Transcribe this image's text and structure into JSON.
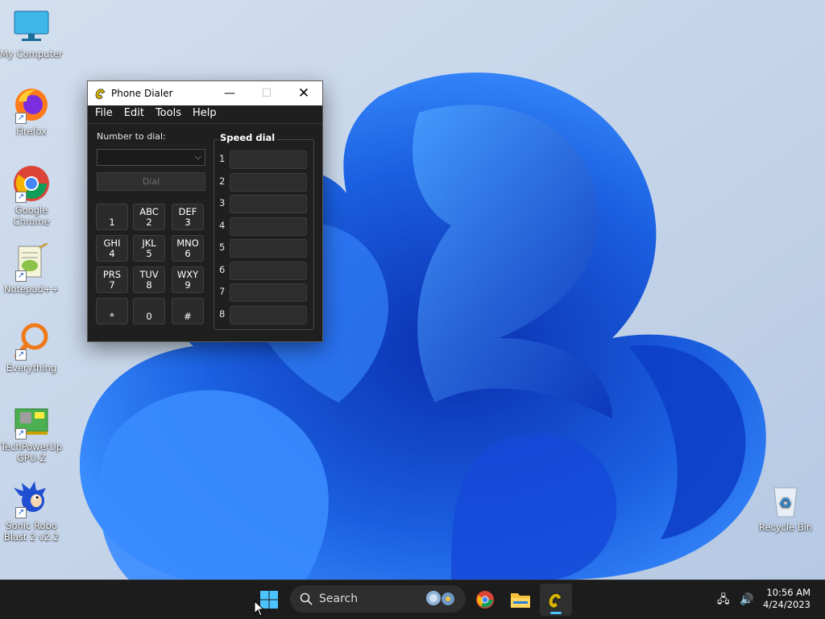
{
  "desktop": {
    "icons": [
      {
        "name": "my-computer",
        "label": "My Computer"
      },
      {
        "name": "firefox",
        "label": "Firefox"
      },
      {
        "name": "google-chrome",
        "label": "Google Chrome"
      },
      {
        "name": "notepad-plus-plus",
        "label": "Notepad++"
      },
      {
        "name": "everything",
        "label": "Everything"
      },
      {
        "name": "gpu-z",
        "label": "TechPowerUp GPU-Z"
      },
      {
        "name": "sonic-robo-blast",
        "label": "Sonic Robo Blast 2 v2.2"
      },
      {
        "name": "recycle-bin",
        "label": "Recycle Bin"
      }
    ]
  },
  "window": {
    "title": "Phone Dialer",
    "menu": [
      "File",
      "Edit",
      "Tools",
      "Help"
    ],
    "number_label": "Number to dial:",
    "dial_button": "Dial",
    "keypad": [
      {
        "letters": "",
        "digit": "1"
      },
      {
        "letters": "ABC",
        "digit": "2"
      },
      {
        "letters": "DEF",
        "digit": "3"
      },
      {
        "letters": "GHI",
        "digit": "4"
      },
      {
        "letters": "JKL",
        "digit": "5"
      },
      {
        "letters": "MNO",
        "digit": "6"
      },
      {
        "letters": "PRS",
        "digit": "7"
      },
      {
        "letters": "TUV",
        "digit": "8"
      },
      {
        "letters": "WXY",
        "digit": "9"
      },
      {
        "letters": "",
        "digit": "*"
      },
      {
        "letters": "",
        "digit": "0"
      },
      {
        "letters": "",
        "digit": "#"
      }
    ],
    "speed_dial_title": "Speed dial",
    "speed_dial_numbers": [
      "1",
      "2",
      "3",
      "4",
      "5",
      "6",
      "7",
      "8"
    ]
  },
  "taskbar": {
    "search_label": "Search",
    "time": "10:56 AM",
    "date": "4/24/2023",
    "icons": [
      "start-icon",
      "search-icon",
      "chrome-icon",
      "file-explorer-icon",
      "phone-dialer-icon",
      "network-icon",
      "volume-icon"
    ]
  },
  "colors": {
    "wallpaper_bg": "#c9d8ec",
    "bloom_blue": "#1a5fe0",
    "taskbar": "#1c1c1c",
    "window_bg": "#1f1f1f"
  }
}
